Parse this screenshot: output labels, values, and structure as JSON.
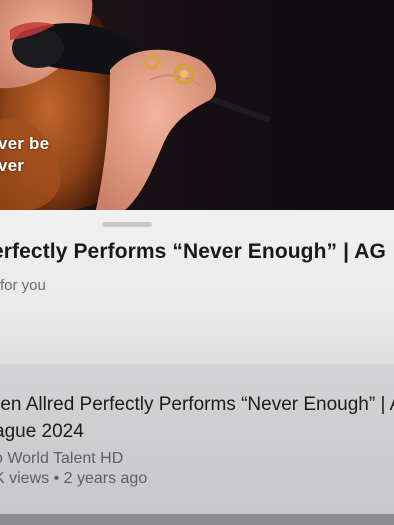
{
  "player": {
    "caption_line_1": "ver be",
    "caption_line_2": "ver"
  },
  "current_video": {
    "title": "erfectly Performs “Never Enough” | AG",
    "meta": "for you"
  },
  "recommended": [
    {
      "title_line_1": "ren Allred Perfectly Performs “Never Enough” | AG",
      "title_line_2": "ague 2024",
      "channel": "o World Talent HD",
      "stats": "K views • 2 years ago"
    }
  ]
}
